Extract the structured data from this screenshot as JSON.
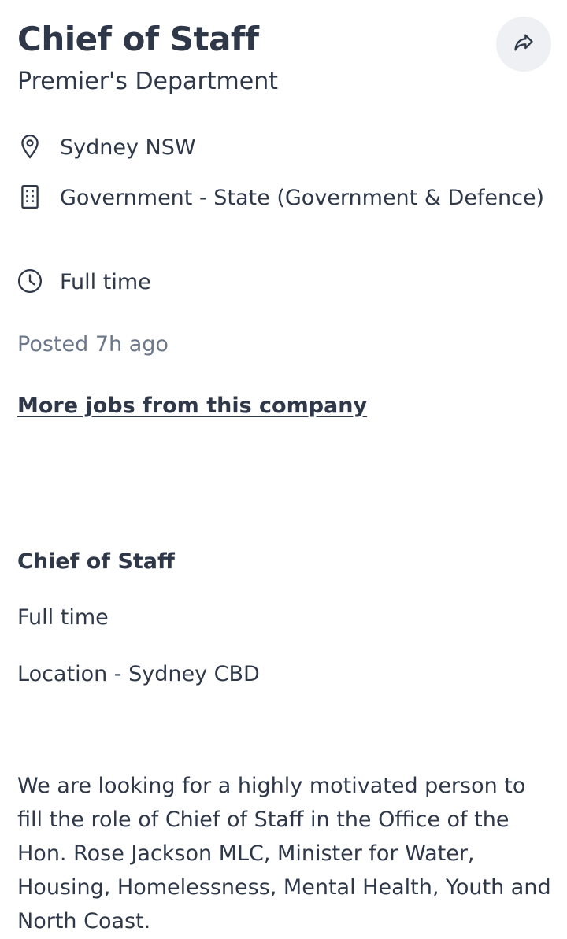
{
  "header": {
    "title": "Chief of Staff",
    "company": "Premier's Department",
    "share_icon": "share-arrow-icon"
  },
  "meta": {
    "location": {
      "icon": "location-pin-icon",
      "text": "Sydney NSW"
    },
    "industry": {
      "icon": "building-icon",
      "text": "Government - State (Government & Defence)"
    },
    "work_type": {
      "icon": "clock-icon",
      "text": "Full time"
    }
  },
  "posted": "Posted 7h ago",
  "more_jobs_link": "More jobs from this company",
  "description": {
    "heading": "Chief of Staff",
    "line1": "Full time",
    "line2": "Location - Sydney CBD",
    "paragraph": "We are looking for a highly motivated person to fill the role of Chief of Staff in the Office of the Hon. Rose Jackson MLC, Minister for Water, Housing, Homelessness, Mental Health, Youth and North Coast."
  },
  "colors": {
    "text": "#2e3849",
    "muted": "#6b778a",
    "share_bg": "#eef0f3"
  }
}
